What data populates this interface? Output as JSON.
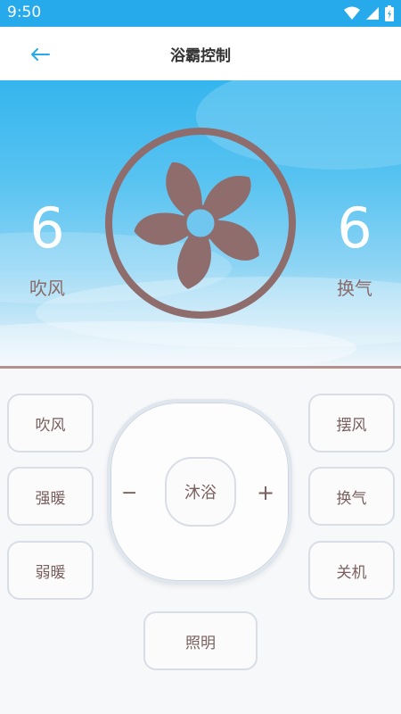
{
  "status_bar": {
    "time": "9:50",
    "icons": [
      "wifi-icon",
      "signal-icon",
      "battery-icon"
    ]
  },
  "app_bar": {
    "title": "浴霸控制",
    "back_icon": "arrow-left-icon"
  },
  "hero": {
    "left": {
      "value": "6",
      "label": "吹风"
    },
    "right": {
      "value": "6",
      "label": "换气"
    },
    "center_icon": "fan-icon"
  },
  "controls": {
    "left": [
      "吹风",
      "强暖",
      "弱暖"
    ],
    "right": [
      "摆风",
      "换气",
      "关机"
    ],
    "dpad": {
      "minus": "−",
      "center": "沐浴",
      "plus": "+"
    },
    "bottom": "照明"
  },
  "colors": {
    "status_bar": "#27aaeb",
    "accent": "#27aaeb",
    "fan": "#8f6d6d",
    "text": "#7a5f5f"
  }
}
